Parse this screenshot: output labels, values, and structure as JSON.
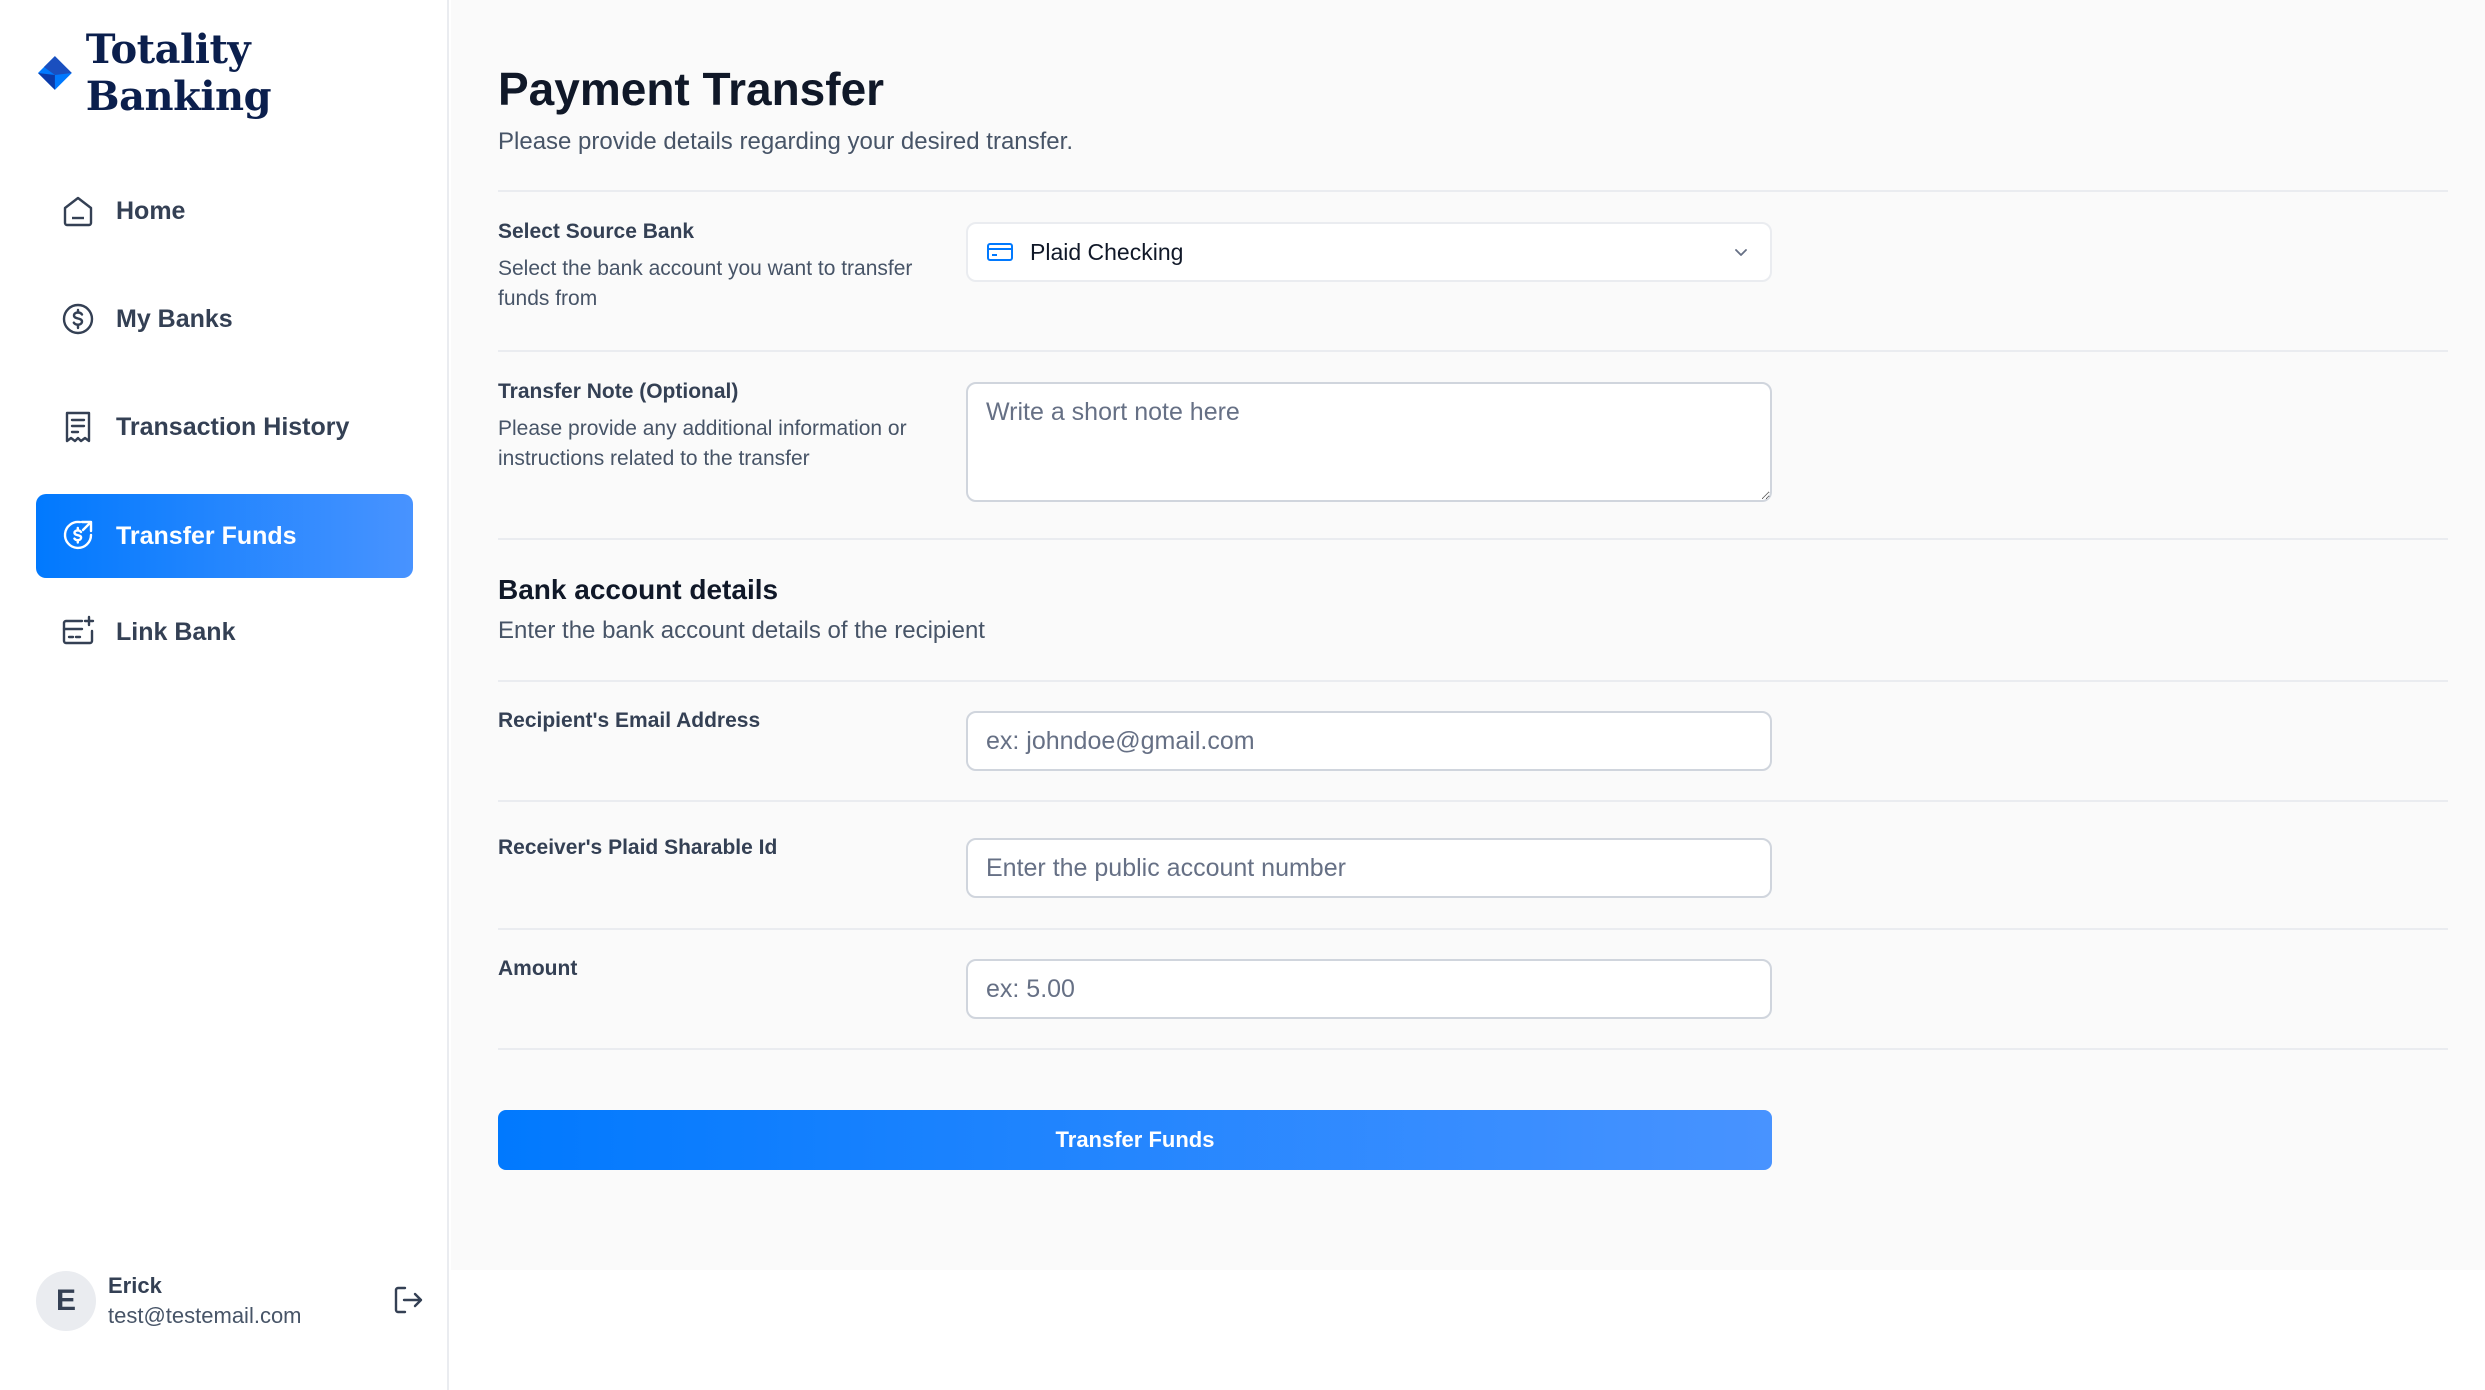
{
  "app": {
    "brand": "Totality Banking"
  },
  "sidebar": {
    "items": [
      {
        "label": "Home",
        "icon": "home-icon"
      },
      {
        "label": "My Banks",
        "icon": "dollar-circle-icon"
      },
      {
        "label": "Transaction History",
        "icon": "receipt-icon"
      },
      {
        "label": "Transfer Funds",
        "icon": "money-send-icon",
        "active": true
      },
      {
        "label": "Link Bank",
        "icon": "card-add-icon"
      }
    ],
    "user": {
      "initial": "E",
      "name": "Erick",
      "email": "test@testemail.com"
    }
  },
  "page": {
    "title": "Payment Transfer",
    "subtitle": "Please provide details regarding your desired transfer."
  },
  "form": {
    "source_bank": {
      "label": "Select Source Bank",
      "help": "Select the bank account you want to transfer funds from",
      "selected": "Plaid Checking"
    },
    "note": {
      "label": "Transfer Note (Optional)",
      "help": "Please provide any additional information or instructions related to the transfer",
      "placeholder": "Write a short note here",
      "value": ""
    },
    "section": {
      "title": "Bank account details",
      "subtitle": "Enter the bank account details of the recipient"
    },
    "email": {
      "label": "Recipient's Email Address",
      "placeholder": "ex: johndoe@gmail.com",
      "value": ""
    },
    "sharable_id": {
      "label": "Receiver's Plaid Sharable Id",
      "placeholder": "Enter the public account number",
      "value": ""
    },
    "amount": {
      "label": "Amount",
      "placeholder": "ex: 5.00",
      "value": ""
    },
    "submit_label": "Transfer Funds"
  },
  "colors": {
    "accent": "#0179FE",
    "accent_light": "#4893FF",
    "brand_text": "#0B1F4D",
    "main_bg": "#FAFAFA"
  }
}
